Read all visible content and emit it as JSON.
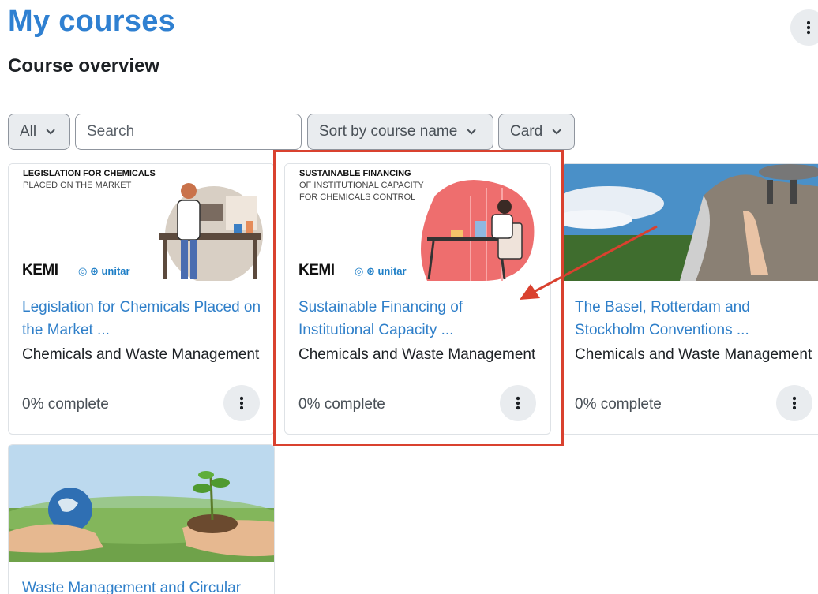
{
  "header": {
    "title": "My courses",
    "section_title": "Course overview"
  },
  "filters": {
    "grouping": "All",
    "search_placeholder": "Search",
    "sort": "Sort by course name",
    "view": "Card"
  },
  "courses": [
    {
      "banner_line1": "LEGISLATION FOR CHEMICALS",
      "banner_line2": "PLACED ON THE MARKET",
      "title_line1": "Legislation for Chemicals Placed on",
      "title_line2": "the Market ...",
      "category": "Chemicals and Waste Management",
      "progress": "0% complete",
      "progress_value": 0
    },
    {
      "banner_line1": "SUSTAINABLE FINANCING",
      "banner_line2": "OF INSTITUTIONAL CAPACITY",
      "banner_line3": "FOR CHEMICALS CONTROL",
      "title_line1": "Sustainable Financing of",
      "title_line2": "Institutional Capacity ...",
      "category": "Chemicals and Waste Management",
      "progress": "0% complete",
      "progress_value": 0
    },
    {
      "title_line1": "The Basel, Rotterdam and",
      "title_line2": "Stockholm Conventions ...",
      "category": "Chemicals and Waste Management",
      "progress": "0% complete",
      "progress_value": 0
    },
    {
      "title_line1": "Waste Management and Circular"
    }
  ],
  "logos": {
    "kemi": "KEMI",
    "unitar": "unitar"
  },
  "colors": {
    "accent": "#2f80d1",
    "link": "#2f7fc9",
    "annotation": "#d9412f",
    "button_bg": "#e9ecef"
  }
}
